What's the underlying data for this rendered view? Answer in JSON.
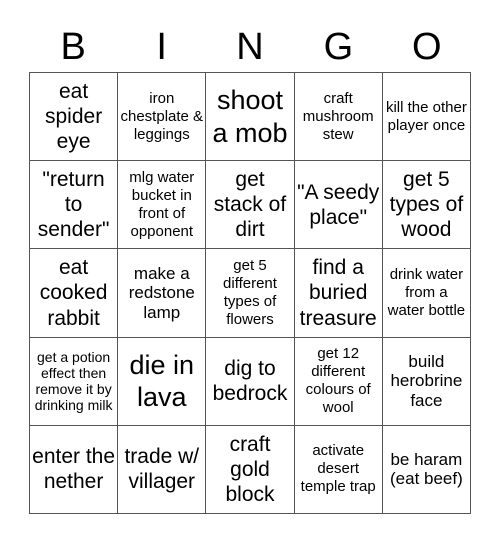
{
  "header": [
    "B",
    "I",
    "N",
    "G",
    "O"
  ],
  "cells": [
    {
      "text": "eat spider eye",
      "size": "l"
    },
    {
      "text": "iron chestplate & leggings",
      "size": "s"
    },
    {
      "text": "shoot a mob",
      "size": "xl"
    },
    {
      "text": "craft mushroom stew",
      "size": "s"
    },
    {
      "text": "kill the other player once",
      "size": "s"
    },
    {
      "text": "\"return to sender\"",
      "size": "l"
    },
    {
      "text": "mlg water bucket in front of opponent",
      "size": "s"
    },
    {
      "text": "get stack of dirt",
      "size": "l"
    },
    {
      "text": "\"A seedy place\"",
      "size": "l"
    },
    {
      "text": "get 5 types of wood",
      "size": "l"
    },
    {
      "text": "eat cooked rabbit",
      "size": "l"
    },
    {
      "text": "make a redstone lamp",
      "size": "m"
    },
    {
      "text": "get 5 different types of flowers",
      "size": "s"
    },
    {
      "text": "find a buried treasure",
      "size": "l"
    },
    {
      "text": "drink water from a water bottle",
      "size": "s"
    },
    {
      "text": "get a potion effect then remove it by drinking milk",
      "size": "xs"
    },
    {
      "text": "die in lava",
      "size": "xl"
    },
    {
      "text": "dig to bedrock",
      "size": "l"
    },
    {
      "text": "get 12 different colours of wool",
      "size": "s"
    },
    {
      "text": "build herobrine face",
      "size": "m"
    },
    {
      "text": "enter the nether",
      "size": "l"
    },
    {
      "text": "trade w/ villager",
      "size": "l"
    },
    {
      "text": "craft gold block",
      "size": "l"
    },
    {
      "text": "activate desert temple trap",
      "size": "s"
    },
    {
      "text": "be haram (eat beef)",
      "size": "m"
    }
  ]
}
